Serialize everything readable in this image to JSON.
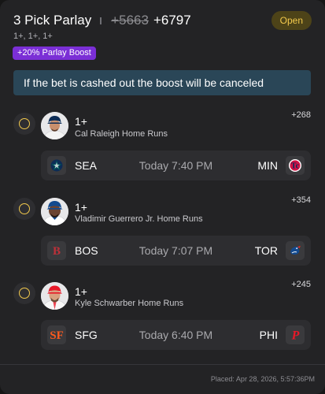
{
  "header": {
    "title": "3 Pick Parlay",
    "old_odds": "+5663",
    "new_odds": "+6797",
    "status": "Open",
    "legs_summary": "1+, 1+, 1+",
    "boost_label": "+20% Parlay Boost"
  },
  "notice": "If the bet is cashed out the boost will be canceled",
  "legs": [
    {
      "line": "1+",
      "description": "Cal Raleigh Home Runs",
      "odds": "+268",
      "away": "SEA",
      "home": "MIN",
      "time": "Today 7:40 PM",
      "away_icon": "mariners-logo-icon",
      "home_icon": "twins-logo-icon"
    },
    {
      "line": "1+",
      "description": "Vladimir Guerrero Jr. Home Runs",
      "odds": "+354",
      "away": "BOS",
      "home": "TOR",
      "time": "Today 7:07 PM",
      "away_icon": "red-sox-logo-icon",
      "home_icon": "blue-jays-logo-icon"
    },
    {
      "line": "1+",
      "description": "Kyle Schwarber Home Runs",
      "odds": "+245",
      "away": "SFG",
      "home": "PHI",
      "time": "Today 6:40 PM",
      "away_icon": "giants-logo-icon",
      "home_icon": "phillies-logo-icon"
    }
  ],
  "footer": {
    "placed": "Placed: Apr 28, 2026, 5:57:36PM"
  },
  "colors": {
    "status_bg": "#4d4318",
    "status_text": "#f2c94c",
    "boost_bg": "#7b2fd6",
    "notice_bg": "#2a4657"
  }
}
